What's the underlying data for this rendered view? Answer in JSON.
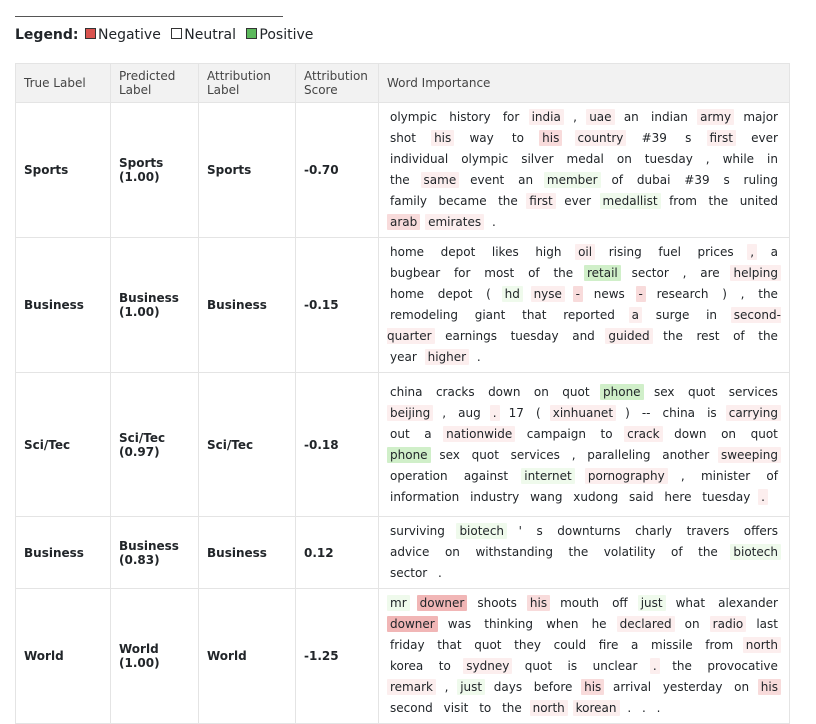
{
  "legend": {
    "title": "Legend:",
    "items": [
      {
        "label": "Negative",
        "color": "#d9534f"
      },
      {
        "label": "Neutral",
        "color": "#ffffff"
      },
      {
        "label": "Positive",
        "color": "#5cb85c"
      }
    ]
  },
  "table": {
    "headers": [
      "True Label",
      "Predicted Label",
      "Attribution Label",
      "Attribution Score",
      "Word Importance"
    ],
    "rows": [
      {
        "true_label": "Sports",
        "predicted_label": "Sports (1.00)",
        "attribution_label": "Sports",
        "attribution_score": "-0.70",
        "words": [
          [
            "olympic",
            0
          ],
          [
            "history",
            0
          ],
          [
            "for",
            0
          ],
          [
            "india",
            1
          ],
          [
            ",",
            0
          ],
          [
            "uae",
            1
          ],
          [
            "an",
            0
          ],
          [
            "indian",
            0
          ],
          [
            "army",
            1
          ],
          [
            "major",
            0
          ],
          [
            "shot",
            0
          ],
          [
            "his",
            1
          ],
          [
            "way",
            0
          ],
          [
            "to",
            0
          ],
          [
            "his",
            2
          ],
          [
            "country",
            1
          ],
          [
            "#39",
            0
          ],
          [
            "s",
            0
          ],
          [
            "first",
            1
          ],
          [
            "ever",
            0
          ],
          [
            "individual",
            0
          ],
          [
            "olympic",
            0
          ],
          [
            "silver",
            0
          ],
          [
            "medal",
            0
          ],
          [
            "on",
            0
          ],
          [
            "tuesday",
            0
          ],
          [
            ",",
            0
          ],
          [
            "while",
            0
          ],
          [
            "in",
            0
          ],
          [
            "the",
            0
          ],
          [
            "same",
            1
          ],
          [
            "event",
            0
          ],
          [
            "an",
            0
          ],
          [
            "member",
            -1
          ],
          [
            "of",
            0
          ],
          [
            "dubai",
            0
          ],
          [
            "#39",
            0
          ],
          [
            "s",
            0
          ],
          [
            "ruling",
            0
          ],
          [
            "family",
            0
          ],
          [
            "became",
            0
          ],
          [
            "the",
            0
          ],
          [
            "first",
            1
          ],
          [
            "ever",
            0
          ],
          [
            "medallist",
            -1
          ],
          [
            "from",
            0
          ],
          [
            "the",
            0
          ],
          [
            "united",
            0
          ],
          [
            "arab",
            2
          ],
          [
            "emirates",
            1
          ],
          [
            ".",
            0
          ]
        ]
      },
      {
        "true_label": "Business",
        "predicted_label": "Business (1.00)",
        "attribution_label": "Business",
        "attribution_score": "-0.15",
        "words": [
          [
            "home",
            0
          ],
          [
            "depot",
            0
          ],
          [
            "likes",
            0
          ],
          [
            "high",
            0
          ],
          [
            "oil",
            1
          ],
          [
            "rising",
            0
          ],
          [
            "fuel",
            0
          ],
          [
            "prices",
            0
          ],
          [
            ",",
            1
          ],
          [
            "a",
            0
          ],
          [
            "bugbear",
            0
          ],
          [
            "for",
            0
          ],
          [
            "most",
            0
          ],
          [
            "of",
            0
          ],
          [
            "the",
            0
          ],
          [
            "retail",
            -2
          ],
          [
            "sector",
            0
          ],
          [
            ",",
            0
          ],
          [
            "are",
            0
          ],
          [
            "helping",
            1
          ],
          [
            "home",
            0
          ],
          [
            "depot",
            0
          ],
          [
            "(",
            0
          ],
          [
            "hd",
            -1
          ],
          [
            "nyse",
            1
          ],
          [
            "-",
            2
          ],
          [
            "news",
            0
          ],
          [
            "-",
            2
          ],
          [
            "research",
            0
          ],
          [
            ")",
            0
          ],
          [
            ",",
            0
          ],
          [
            "the",
            0
          ],
          [
            "remodeling",
            0
          ],
          [
            "giant",
            0
          ],
          [
            "that",
            0
          ],
          [
            "reported",
            0
          ],
          [
            "a",
            1
          ],
          [
            "surge",
            0
          ],
          [
            "in",
            0
          ],
          [
            "second-quarter",
            1
          ],
          [
            "earnings",
            0
          ],
          [
            "tuesday",
            0
          ],
          [
            "and",
            0
          ],
          [
            "guided",
            1
          ],
          [
            "the",
            0
          ],
          [
            "rest",
            0
          ],
          [
            "of",
            0
          ],
          [
            "the",
            0
          ],
          [
            "year",
            0
          ],
          [
            "higher",
            1
          ],
          [
            ".",
            0
          ]
        ]
      },
      {
        "true_label": "Sci/Tec",
        "predicted_label": "Sci/Tec (0.97)",
        "attribution_label": "Sci/Tec",
        "attribution_score": "-0.18",
        "words": [
          [
            "china",
            0
          ],
          [
            "cracks",
            0
          ],
          [
            "down",
            0
          ],
          [
            "on",
            0
          ],
          [
            "quot",
            0
          ],
          [
            "phone",
            -2
          ],
          [
            "sex",
            0
          ],
          [
            "quot",
            0
          ],
          [
            "services",
            0
          ],
          [
            "beijing",
            1
          ],
          [
            ",",
            0
          ],
          [
            "aug",
            0
          ],
          [
            ".",
            1
          ],
          [
            "17",
            0
          ],
          [
            "(",
            0
          ],
          [
            "xinhuanet",
            1
          ],
          [
            ")",
            0
          ],
          [
            "--",
            0
          ],
          [
            "china",
            0
          ],
          [
            "is",
            0
          ],
          [
            "carrying",
            1
          ],
          [
            "out",
            0
          ],
          [
            "a",
            0
          ],
          [
            "nationwide",
            1
          ],
          [
            "campaign",
            0
          ],
          [
            "to",
            0
          ],
          [
            "crack",
            1
          ],
          [
            "down",
            0
          ],
          [
            "on",
            0
          ],
          [
            "quot",
            0
          ],
          [
            "phone",
            -2
          ],
          [
            "sex",
            0
          ],
          [
            "quot",
            0
          ],
          [
            "services",
            0
          ],
          [
            ",",
            0
          ],
          [
            "paralleling",
            0
          ],
          [
            "another",
            0
          ],
          [
            "sweeping",
            1
          ],
          [
            "operation",
            0
          ],
          [
            "against",
            0
          ],
          [
            "internet",
            -1
          ],
          [
            "pornography",
            1
          ],
          [
            ",",
            0
          ],
          [
            "minister",
            0
          ],
          [
            "of",
            0
          ],
          [
            "information",
            0
          ],
          [
            "industry",
            0
          ],
          [
            "wang",
            0
          ],
          [
            "xudong",
            0
          ],
          [
            "said",
            0
          ],
          [
            "here",
            0
          ],
          [
            "tuesday",
            0
          ],
          [
            ".",
            1
          ]
        ]
      },
      {
        "true_label": "Business",
        "predicted_label": "Business (0.83)",
        "attribution_label": "Business",
        "attribution_score": "0.12",
        "words": [
          [
            "surviving",
            0
          ],
          [
            "biotech",
            -1
          ],
          [
            "'",
            0
          ],
          [
            "s",
            0
          ],
          [
            "downturns",
            0
          ],
          [
            "charly",
            0
          ],
          [
            "travers",
            0
          ],
          [
            "offers",
            0
          ],
          [
            "advice",
            0
          ],
          [
            "on",
            0
          ],
          [
            "withstanding",
            0
          ],
          [
            "the",
            0
          ],
          [
            "volatility",
            0
          ],
          [
            "of",
            0
          ],
          [
            "the",
            0
          ],
          [
            "biotech",
            -1
          ],
          [
            "sector",
            0
          ],
          [
            ".",
            0
          ]
        ]
      },
      {
        "true_label": "World",
        "predicted_label": "World (1.00)",
        "attribution_label": "World",
        "attribution_score": "-1.25",
        "words": [
          [
            "mr",
            -1
          ],
          [
            "downer",
            3
          ],
          [
            "shoots",
            0
          ],
          [
            "his",
            2
          ],
          [
            "mouth",
            0
          ],
          [
            "off",
            0
          ],
          [
            "just",
            -1
          ],
          [
            "what",
            0
          ],
          [
            "alexander",
            0
          ],
          [
            "downer",
            3
          ],
          [
            "was",
            0
          ],
          [
            "thinking",
            0
          ],
          [
            "when",
            0
          ],
          [
            "he",
            0
          ],
          [
            "declared",
            1
          ],
          [
            "on",
            0
          ],
          [
            "radio",
            1
          ],
          [
            "last",
            0
          ],
          [
            "friday",
            0
          ],
          [
            "that",
            0
          ],
          [
            "quot",
            0
          ],
          [
            "they",
            0
          ],
          [
            "could",
            0
          ],
          [
            "fire",
            0
          ],
          [
            "a",
            0
          ],
          [
            "missile",
            0
          ],
          [
            "from",
            0
          ],
          [
            "north",
            1
          ],
          [
            "korea",
            0
          ],
          [
            "to",
            0
          ],
          [
            "sydney",
            1
          ],
          [
            "quot",
            0
          ],
          [
            "is",
            0
          ],
          [
            "unclear",
            0
          ],
          [
            ".",
            1
          ],
          [
            "the",
            0
          ],
          [
            "provocative",
            0
          ],
          [
            "remark",
            1
          ],
          [
            ",",
            0
          ],
          [
            "just",
            -1
          ],
          [
            "days",
            0
          ],
          [
            "before",
            0
          ],
          [
            "his",
            2
          ],
          [
            "arrival",
            0
          ],
          [
            "yesterday",
            0
          ],
          [
            "on",
            0
          ],
          [
            "his",
            2
          ],
          [
            "second",
            0
          ],
          [
            "visit",
            0
          ],
          [
            "to",
            0
          ],
          [
            "the",
            0
          ],
          [
            "north",
            1
          ],
          [
            "korean",
            1
          ],
          [
            ".",
            0
          ],
          [
            ".",
            0
          ],
          [
            ".",
            0
          ]
        ]
      }
    ]
  }
}
